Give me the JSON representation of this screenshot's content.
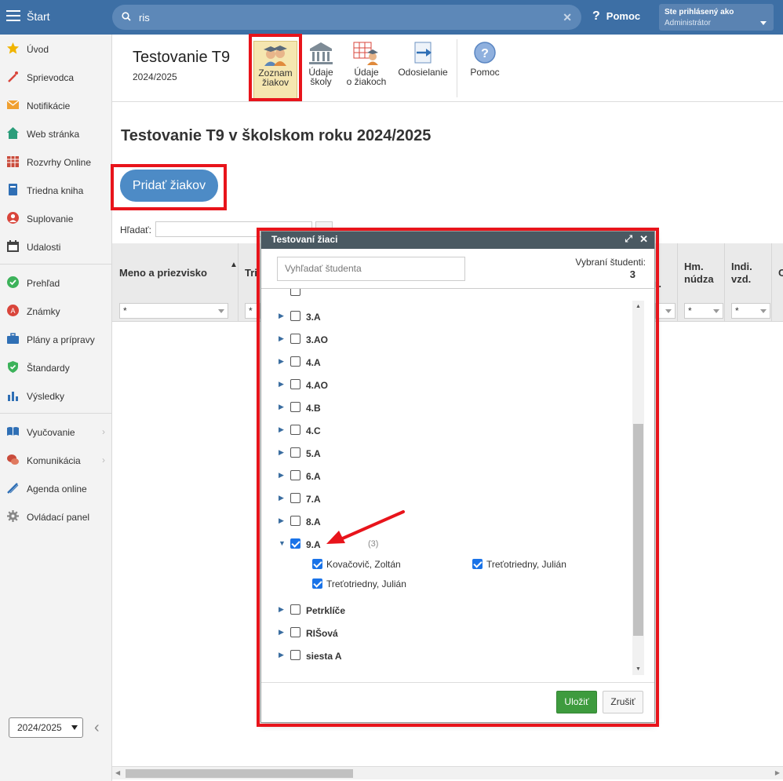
{
  "topbar": {
    "start_label": "Štart",
    "search_value": "ris",
    "help_label": "Pomoc",
    "user_line1": "Ste prihlásený ako",
    "user_line2": "Administrátor"
  },
  "sidebar": {
    "items": [
      {
        "label": "Úvod",
        "icon": "star-icon"
      },
      {
        "label": "Sprievodca",
        "icon": "magic-wand-icon"
      },
      {
        "label": "Notifikácie",
        "icon": "envelope-icon"
      },
      {
        "label": "Web stránka",
        "icon": "home-icon"
      },
      {
        "label": "Rozvrhy Online",
        "icon": "calendar-grid-icon"
      },
      {
        "label": "Triedna kniha",
        "icon": "book-icon"
      },
      {
        "label": "Suplovanie",
        "icon": "person-icon"
      },
      {
        "label": "Udalosti",
        "icon": "calendar-icon"
      },
      {
        "label": "Prehľad",
        "icon": "check-circle-icon"
      },
      {
        "label": "Známky",
        "icon": "grade-icon"
      },
      {
        "label": "Plány a prípravy",
        "icon": "briefcase-icon"
      },
      {
        "label": "Štandardy",
        "icon": "shield-check-icon"
      },
      {
        "label": "Výsledky",
        "icon": "bar-chart-icon"
      },
      {
        "label": "Vyučovanie",
        "icon": "open-book-icon"
      },
      {
        "label": "Komunikácia",
        "icon": "chat-icon"
      },
      {
        "label": "Agenda online",
        "icon": "pen-icon"
      },
      {
        "label": "Ovládací panel",
        "icon": "gear-icon"
      }
    ],
    "year_select": "2024/2025"
  },
  "header": {
    "title": "Testovanie T9",
    "subtitle": "2024/2025",
    "tools": [
      {
        "label1": "Zoznam",
        "label2": "žiakov"
      },
      {
        "label1": "Údaje",
        "label2": "školy"
      },
      {
        "label1": "Údaje",
        "label2": "o žiakoch"
      },
      {
        "label1": "Odosielanie",
        "label2": ""
      },
      {
        "label1": "Pomoc",
        "label2": ""
      }
    ]
  },
  "main": {
    "heading": "Testovanie T9 v školskom roku 2024/2025",
    "add_button": "Pridať žiakov",
    "find_label": "Hľadať:",
    "columns": [
      {
        "line1": "Meno a priezvisko",
        "line2": ""
      },
      {
        "line1": "Tri",
        "line2": ""
      },
      {
        "line1": "",
        "line2": "r."
      },
      {
        "line1": "Hm.",
        "line2": "núdza"
      },
      {
        "line1": "Indi.",
        "line2": "vzd."
      },
      {
        "line1": "O",
        "line2": ""
      }
    ],
    "filter_value": "*"
  },
  "modal": {
    "title": "Testovaní žiaci",
    "search_placeholder": "Vyhľadať študenta",
    "selected_label": "Vybraní študenti:",
    "selected_count": "3",
    "classes": [
      {
        "label": "3.A",
        "checked": false
      },
      {
        "label": "3.AO",
        "checked": false
      },
      {
        "label": "4.A",
        "checked": false
      },
      {
        "label": "4.AO",
        "checked": false
      },
      {
        "label": "4.B",
        "checked": false
      },
      {
        "label": "4.C",
        "checked": false
      },
      {
        "label": "5.A",
        "checked": false
      },
      {
        "label": "6.A",
        "checked": false
      },
      {
        "label": "7.A",
        "checked": false
      },
      {
        "label": "8.A",
        "checked": false
      },
      {
        "label": "9.A",
        "checked": true,
        "count": "(3)",
        "expanded": true
      },
      {
        "label": "Petrklíče",
        "checked": false
      },
      {
        "label": "RIŠová",
        "checked": false
      },
      {
        "label": "siesta A",
        "checked": false
      }
    ],
    "students": [
      "Kovačovič, Zoltán",
      "Treťotriedny, Julián",
      "Treťotriedny, Julián"
    ],
    "save_button": "Uložiť",
    "cancel_button": "Zrušiť"
  },
  "colors": {
    "topbar": "#3d6fa5",
    "highlight": "#e8141b",
    "primary_button": "#4d8bc6",
    "save_button": "#3e9b3e",
    "modal_header": "#4a5962"
  }
}
